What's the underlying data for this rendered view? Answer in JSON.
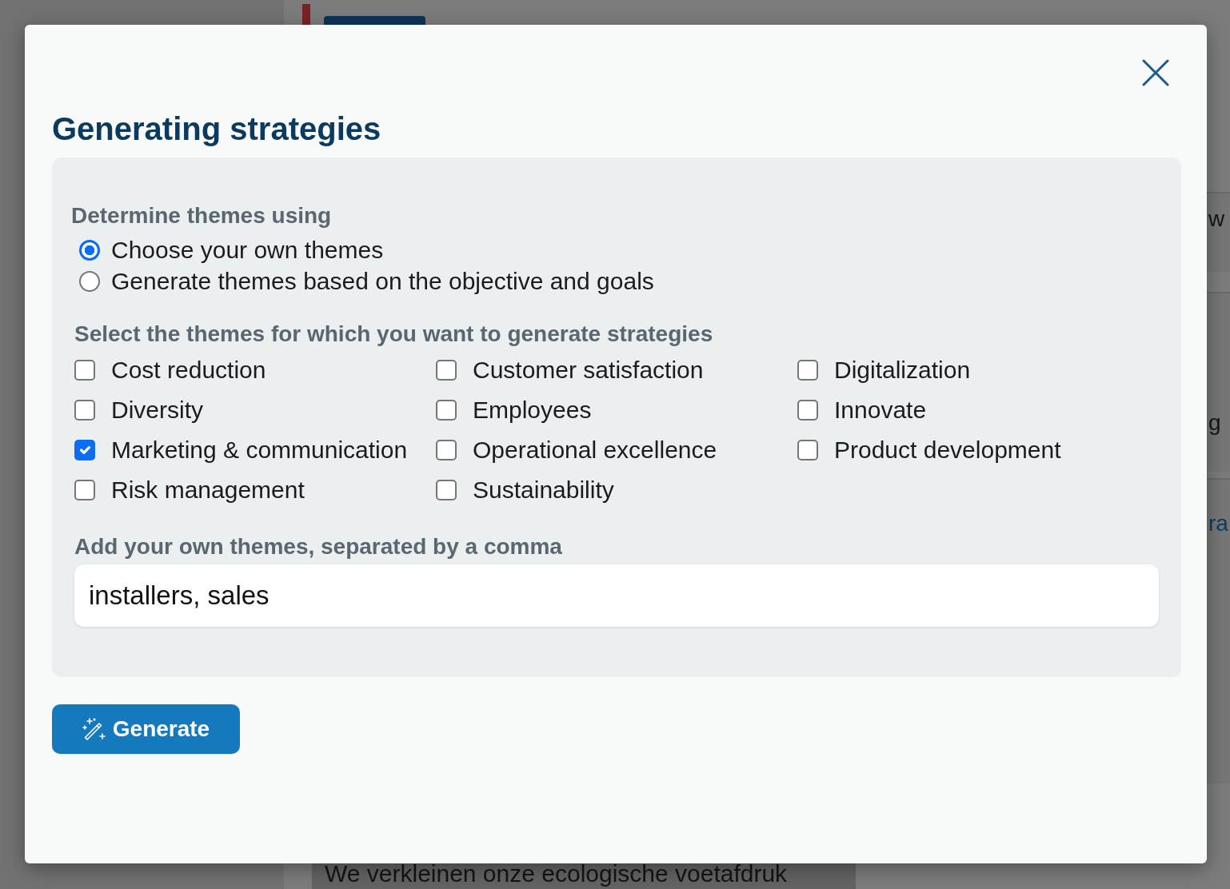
{
  "backdrop": {
    "side_texts": [
      {
        "text": "w",
        "kind": "plain"
      },
      {
        "text": "g",
        "kind": "plain"
      },
      {
        "text": "ra",
        "kind": "link"
      }
    ],
    "bottom_text": "We verkleinen onze ecologische voetafdruk"
  },
  "dialog": {
    "title": "Generating strategies",
    "method": {
      "label": "Determine themes using",
      "options": [
        {
          "label": "Choose your own themes",
          "selected": true
        },
        {
          "label": "Generate themes based on the objective and goals",
          "selected": false
        }
      ]
    },
    "themes": {
      "label": "Select the themes for which you want to generate strategies",
      "items": [
        {
          "label": "Cost reduction",
          "checked": false
        },
        {
          "label": "Customer satisfaction",
          "checked": false
        },
        {
          "label": "Digitalization",
          "checked": false
        },
        {
          "label": "Diversity",
          "checked": false
        },
        {
          "label": "Employees",
          "checked": false
        },
        {
          "label": "Innovate",
          "checked": false
        },
        {
          "label": "Marketing & communication",
          "checked": true
        },
        {
          "label": "Operational excellence",
          "checked": false
        },
        {
          "label": "Product development",
          "checked": false
        },
        {
          "label": "Risk management",
          "checked": false
        },
        {
          "label": "Sustainability",
          "checked": false
        }
      ]
    },
    "custom_themes": {
      "label": "Add your own themes, separated by a comma",
      "value": "installers, sales"
    },
    "generate_button": {
      "label": "Generate"
    }
  }
}
